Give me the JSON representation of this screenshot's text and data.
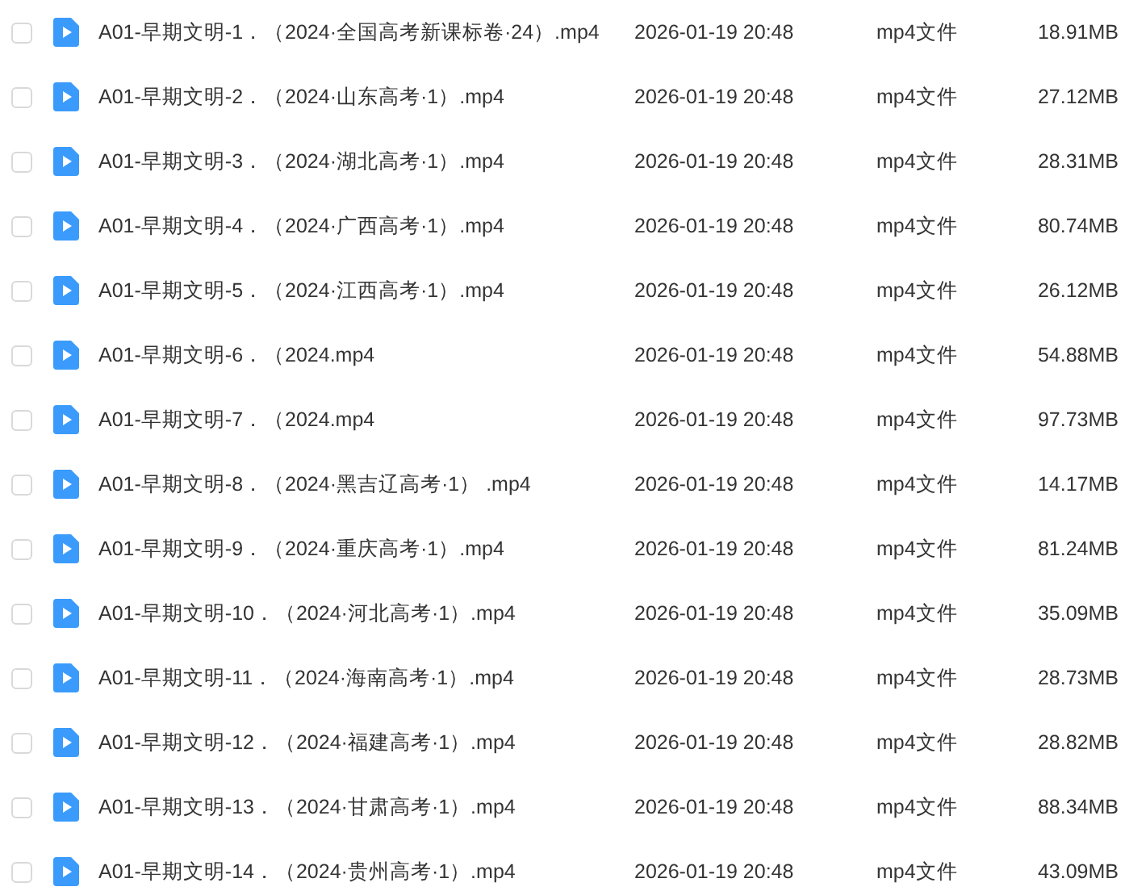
{
  "files": [
    {
      "checked": false,
      "name": "A01-早期文明-1．（2024·全国高考新课标卷·24）.mp4",
      "modified": "2026-01-19 20:48",
      "type": "mp4文件",
      "size": "18.91MB"
    },
    {
      "checked": false,
      "name": "A01-早期文明-2．（2024·山东高考·1）.mp4",
      "modified": "2026-01-19 20:48",
      "type": "mp4文件",
      "size": "27.12MB"
    },
    {
      "checked": false,
      "name": "A01-早期文明-3．（2024·湖北高考·1）.mp4",
      "modified": "2026-01-19 20:48",
      "type": "mp4文件",
      "size": "28.31MB"
    },
    {
      "checked": false,
      "name": "A01-早期文明-4．（2024·广西高考·1）.mp4",
      "modified": "2026-01-19 20:48",
      "type": "mp4文件",
      "size": "80.74MB"
    },
    {
      "checked": false,
      "name": "A01-早期文明-5．（2024·江西高考·1）.mp4",
      "modified": "2026-01-19 20:48",
      "type": "mp4文件",
      "size": "26.12MB"
    },
    {
      "checked": false,
      "name": "A01-早期文明-6．（2024.mp4",
      "modified": "2026-01-19 20:48",
      "type": "mp4文件",
      "size": "54.88MB"
    },
    {
      "checked": false,
      "name": "A01-早期文明-7．（2024.mp4",
      "modified": "2026-01-19 20:48",
      "type": "mp4文件",
      "size": "97.73MB"
    },
    {
      "checked": false,
      "name": "A01-早期文明-8．（2024·黑吉辽高考·1） .mp4",
      "modified": "2026-01-19 20:48",
      "type": "mp4文件",
      "size": "14.17MB"
    },
    {
      "checked": false,
      "name": "A01-早期文明-9．（2024·重庆高考·1）.mp4",
      "modified": "2026-01-19 20:48",
      "type": "mp4文件",
      "size": "81.24MB"
    },
    {
      "checked": false,
      "name": "A01-早期文明-10．（2024·河北高考·1）.mp4",
      "modified": "2026-01-19 20:48",
      "type": "mp4文件",
      "size": "35.09MB"
    },
    {
      "checked": false,
      "name": "A01-早期文明-11．（2024·海南高考·1）.mp4",
      "modified": "2026-01-19 20:48",
      "type": "mp4文件",
      "size": "28.73MB"
    },
    {
      "checked": false,
      "name": "A01-早期文明-12．（2024·福建高考·1）.mp4",
      "modified": "2026-01-19 20:48",
      "type": "mp4文件",
      "size": "28.82MB"
    },
    {
      "checked": false,
      "name": "A01-早期文明-13．（2024·甘肃高考·1）.mp4",
      "modified": "2026-01-19 20:48",
      "type": "mp4文件",
      "size": "88.34MB"
    },
    {
      "checked": false,
      "name": "A01-早期文明-14．（2024·贵州高考·1）.mp4",
      "modified": "2026-01-19 20:48",
      "type": "mp4文件",
      "size": "43.09MB"
    }
  ]
}
